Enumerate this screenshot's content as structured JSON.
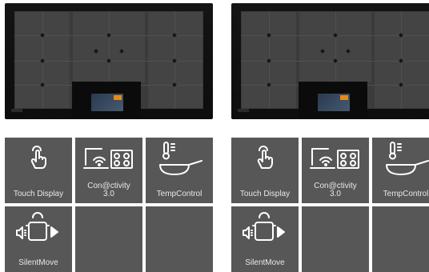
{
  "panels": [
    {
      "features": [
        {
          "label_lines": [
            "Touch Display"
          ],
          "icon": "touch-hand-icon"
        },
        {
          "label_lines": [
            "Con@ctivity",
            "3.0"
          ],
          "icon": "connectivity-hob-icon"
        },
        {
          "label_lines": [
            "TempControl"
          ],
          "icon": "thermometer-pan-icon"
        },
        {
          "label_lines": [
            "SilentMove"
          ],
          "icon": "silent-pot-icon"
        },
        {
          "label_lines": [],
          "icon": ""
        },
        {
          "label_lines": [],
          "icon": ""
        }
      ]
    },
    {
      "features": [
        {
          "label_lines": [
            "Touch Display"
          ],
          "icon": "touch-hand-icon"
        },
        {
          "label_lines": [
            "Con@ctivity",
            "3.0"
          ],
          "icon": "connectivity-hob-icon"
        },
        {
          "label_lines": [
            "TempControl"
          ],
          "icon": "thermometer-pan-icon"
        },
        {
          "label_lines": [
            "SilentMove"
          ],
          "icon": "silent-pot-icon"
        },
        {
          "label_lines": [],
          "icon": ""
        },
        {
          "label_lines": [],
          "icon": ""
        }
      ]
    }
  ],
  "colors": {
    "tile_bg": "#575757",
    "icon": "#ffffff",
    "screen_accent": "#e68a1a"
  }
}
